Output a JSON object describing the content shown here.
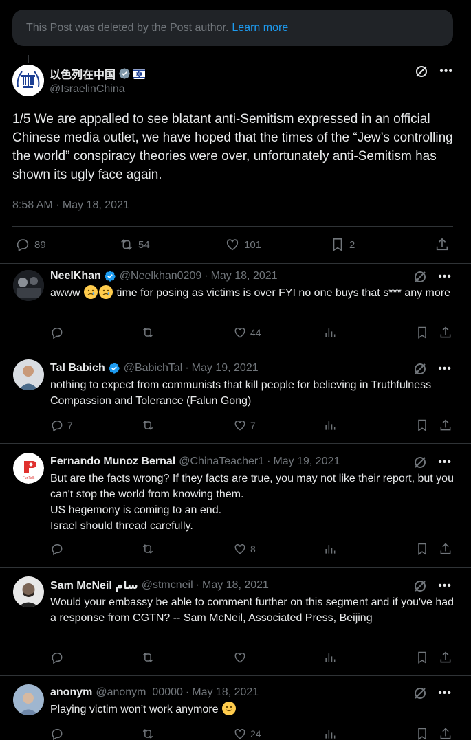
{
  "notice": {
    "text": "This Post was deleted by the Post author.",
    "link": "Learn more"
  },
  "post": {
    "display_name": "以色列在中国",
    "handle": "@IsraelinChina",
    "text": "1/5 We are appalled to see blatant anti-Semitism expressed in an official Chinese media outlet, we have hoped that the times of the “Jew’s controlling the world” conspiracy theories were over, unfortunately anti-Semitism has shown its ugly face again.",
    "timestamp": "8:58 AM · May 18, 2021",
    "replies": "89",
    "reposts": "54",
    "likes": "101",
    "bookmarks": "2"
  },
  "replies": [
    {
      "name": "NeelKhan",
      "handle": "@Neelkhan0209",
      "date": "May 18, 2021",
      "verified": true,
      "text_before": "awww",
      "text_after": "time for posing as victims is over FYI no one buys that s*** any more",
      "replies": "",
      "reposts": "",
      "likes": "44"
    },
    {
      "name": "Tal Babich",
      "handle": "@BabichTal",
      "date": "May 19, 2021",
      "verified": true,
      "text": "nothing to expect from communists that kill people for believing in Truthfulness Compassion and Tolerance (Falun Gong)",
      "replies": "7",
      "reposts": "",
      "likes": "7"
    },
    {
      "name": "Fernando Munoz Bernal",
      "handle": "@ChinaTeacher1",
      "date": "May 19, 2021",
      "verified": false,
      "text": "But are the facts wrong? If they facts are true,  you may not like their report, but you can't stop the world from knowing them.\nUS hegemony is coming to an end.\nIsrael should thread carefully.",
      "replies": "",
      "reposts": "",
      "likes": "8"
    },
    {
      "name": "Sam McNeil سام",
      "handle": "@stmcneil",
      "date": "May 18, 2021",
      "verified": false,
      "text": "Would your embassy be able to comment further on this segment and if you've had a response from CGTN? -- Sam McNeil, Associated Press, Beijing",
      "replies": "",
      "reposts": "",
      "likes": ""
    },
    {
      "name": "anonym",
      "handle": "@anonym_00000",
      "date": "May 18, 2021",
      "verified": false,
      "text": "Playing victim won’t work anymore",
      "replies": "",
      "reposts": "",
      "likes": "24"
    }
  ],
  "colors": {
    "accent": "#1d9bf0",
    "muted": "#71767b",
    "text": "#e7e9ea",
    "bg": "#000000"
  },
  "icons": [
    "reply-icon",
    "repost-icon",
    "like-icon",
    "views-icon",
    "bookmark-icon",
    "share-icon",
    "grok-icon",
    "more-icon",
    "verified-icon"
  ]
}
